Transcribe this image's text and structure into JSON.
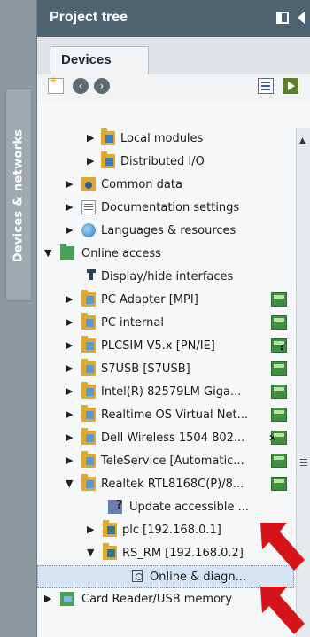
{
  "side_tab": {
    "label": "Devices & networks"
  },
  "header": {
    "title": "Project tree"
  },
  "tabs": [
    {
      "label": "Devices"
    }
  ],
  "tree": {
    "rows": [
      {
        "label": "Local modules"
      },
      {
        "label": "Distributed I/O"
      },
      {
        "label": "Common data"
      },
      {
        "label": "Documentation settings"
      },
      {
        "label": "Languages & resources"
      },
      {
        "label": "Online access"
      },
      {
        "label": "Display/hide interfaces"
      },
      {
        "label": "PC Adapter [MPI]"
      },
      {
        "label": "PC internal"
      },
      {
        "label": "PLCSIM V5.x [PN/IE]"
      },
      {
        "label": "S7USB [S7USB]"
      },
      {
        "label": "Intel(R) 82579LM Giga..."
      },
      {
        "label": "Realtime OS Virtual Net..."
      },
      {
        "label": "Dell Wireless 1504 802..."
      },
      {
        "label": "TeleService [Automatic..."
      },
      {
        "label": "Realtek RTL8168C(P)/8..."
      },
      {
        "label": "Update accessible ..."
      },
      {
        "label": "plc [192.168.0.1]"
      },
      {
        "label": "RS_RM [192.168.0.2]"
      },
      {
        "label": "Online & diagn..."
      },
      {
        "label": "Card Reader/USB memory"
      }
    ]
  },
  "colors": {
    "header_bg": "#4e6473",
    "side_bg": "#8d98a1",
    "selection": "#d6e3f4",
    "annotation": "#d8141b"
  }
}
